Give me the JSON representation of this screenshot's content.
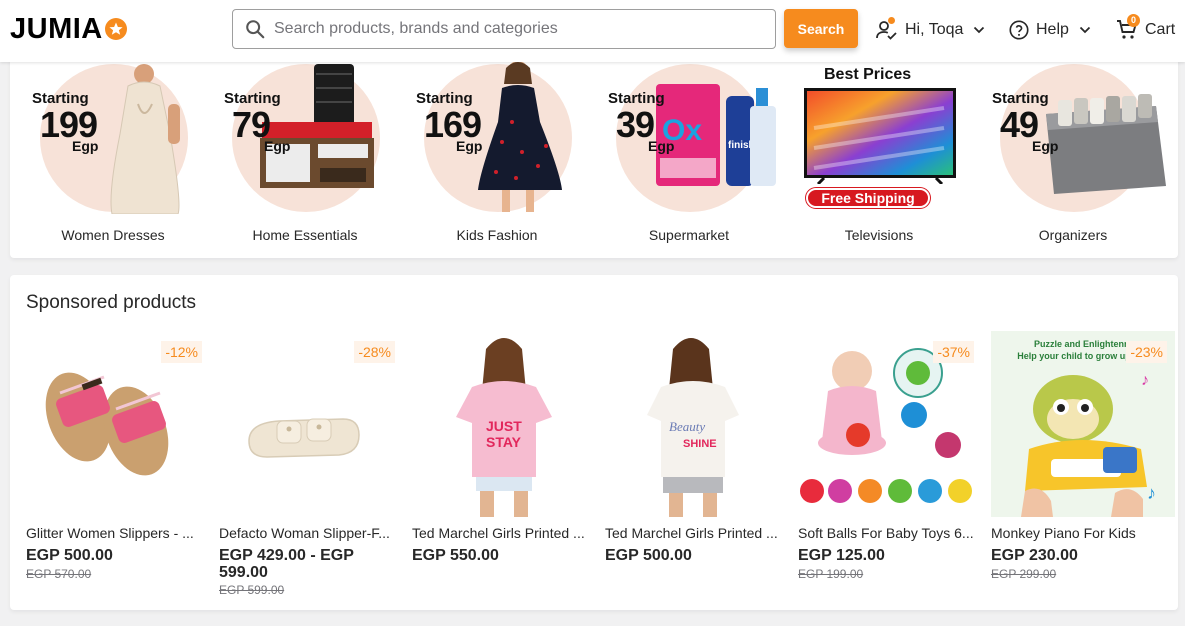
{
  "header": {
    "logo_text": "JUMIA",
    "search_placeholder": "Search products, brands and categories",
    "search_button": "Search",
    "account_label": "Hi, Toqa",
    "help_label": "Help",
    "cart_label": "Cart",
    "cart_count": "0",
    "accent_color": "#f68b1e"
  },
  "categories": [
    {
      "starting": "Starting",
      "price": "199",
      "currency": "Egp",
      "name": "Women Dresses"
    },
    {
      "starting": "Starting",
      "price": "79",
      "currency": "Egp",
      "name": "Home Essentials"
    },
    {
      "starting": "Starting",
      "price": "169",
      "currency": "Egp",
      "name": "Kids Fashion"
    },
    {
      "starting": "Starting",
      "price": "39",
      "currency": "Egp",
      "name": "Supermarket"
    },
    {
      "title": "Best Prices",
      "badge": "Free Shipping",
      "name": "Televisions"
    },
    {
      "starting": "Starting",
      "price": "49",
      "currency": "Egp",
      "name": "Organizers"
    }
  ],
  "sponsored": {
    "title": "Sponsored products",
    "products": [
      {
        "name": "Glitter Women Slippers - ...",
        "price": "EGP 500.00",
        "old_price": "EGP 570.00",
        "discount": "-12%"
      },
      {
        "name": "Defacto Woman Slipper-F...",
        "price": "EGP 429.00 - EGP 599.00",
        "old_price": "EGP 599.00",
        "discount": "-28%"
      },
      {
        "name": "Ted Marchel Girls Printed ...",
        "price": "EGP 550.00",
        "old_price": "",
        "discount": ""
      },
      {
        "name": "Ted Marchel Girls Printed ...",
        "price": "EGP 500.00",
        "old_price": "",
        "discount": ""
      },
      {
        "name": "Soft Balls For Baby Toys 6...",
        "price": "EGP 125.00",
        "old_price": "EGP 199.00",
        "discount": "-37%"
      },
      {
        "name": "Monkey Piano For Kids",
        "price": "EGP 230.00",
        "old_price": "EGP 299.00",
        "discount": "-23%",
        "image_text_1": "Puzzle and Enlightenm",
        "image_text_2": "Help your child to grow up in a"
      }
    ]
  }
}
